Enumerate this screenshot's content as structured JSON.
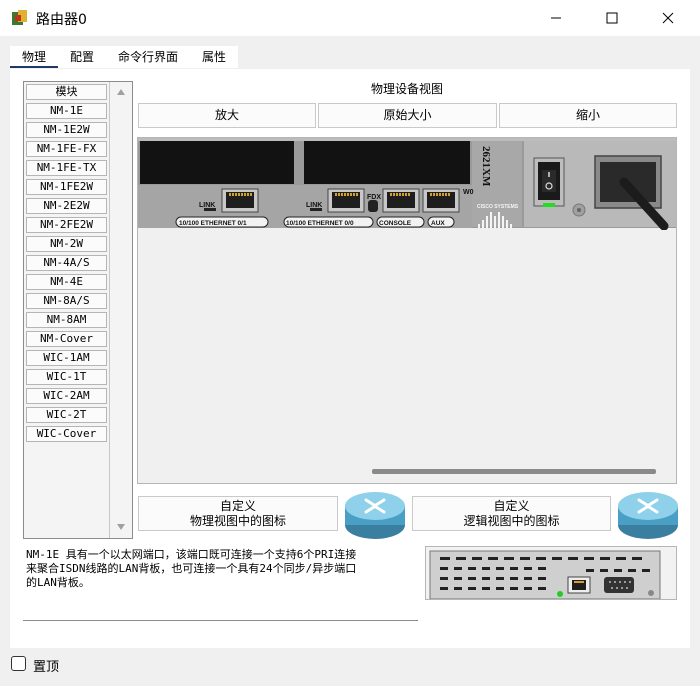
{
  "window": {
    "title": "路由器0",
    "pin_label": "置顶"
  },
  "tabs": [
    {
      "label": "物理",
      "active": true
    },
    {
      "label": "配置",
      "active": false
    },
    {
      "label": "命令行界面",
      "active": false
    },
    {
      "label": "属性",
      "active": false
    }
  ],
  "modules": {
    "header": "模块",
    "items": [
      "NM-1E",
      "NM-1E2W",
      "NM-1FE-FX",
      "NM-1FE-TX",
      "NM-1FE2W",
      "NM-2E2W",
      "NM-2FE2W",
      "NM-2W",
      "NM-4A/S",
      "NM-4E",
      "NM-8A/S",
      "NM-8AM",
      "NM-Cover",
      "WIC-1AM",
      "WIC-1T",
      "WIC-2AM",
      "WIC-2T",
      "WIC-Cover"
    ]
  },
  "physical_view": {
    "title": "物理设备视图",
    "zoom_in": "放大",
    "original_size": "原始大小",
    "zoom_out": "缩小",
    "device_model": "2621XM",
    "brand": "CISCO SYSTEMS",
    "ports": {
      "link1": "LINK",
      "eth01": "10/100 ETHERNET 0/1",
      "link0": "LINK",
      "eth00": "10/100 ETHERNET 0/0",
      "fdx": "FDX",
      "w0": "W0",
      "console": "CONSOLE",
      "aux": "AUX"
    }
  },
  "custom_physical": {
    "line1": "自定义",
    "line2": "物理视图中的图标"
  },
  "custom_logical": {
    "line1": "自定义",
    "line2": "逻辑视图中的图标"
  },
  "description": {
    "lines": [
      "NM-1E 具有一个以太网端口，该端口既可连接一个支持6个PRI连接",
      "来聚合ISDN线路的LAN背板，也可连接一个具有24个同步/异步端口",
      "的LAN背板。"
    ]
  },
  "icons": {
    "app": "router-app-icon",
    "minimize": "minimize-icon",
    "maximize": "maximize-icon",
    "close": "close-icon",
    "router": "router-icon"
  }
}
